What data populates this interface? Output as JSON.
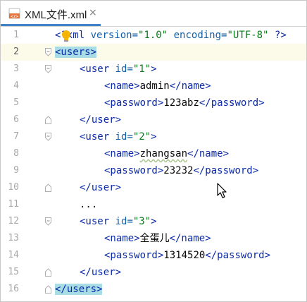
{
  "tab": {
    "title": "XML文件.xml",
    "close_glyph": "×",
    "file_icon": "xml-file-icon"
  },
  "line_numbers": [
    "1",
    "2",
    "3",
    "4",
    "5",
    "6",
    "7",
    "8",
    "9",
    "10",
    "11",
    "12",
    "13",
    "14",
    "15",
    "16"
  ],
  "lines": {
    "l1": {
      "lt": "<",
      "rest_tag": "?xml",
      "attr1": " version=",
      "val1": "\"1.0\"",
      "attr2": " encoding=",
      "val2": "\"UTF-8\"",
      "end": " ?>"
    },
    "l2": {
      "open": "<users>"
    },
    "l3": {
      "tag": "<user",
      "attr": " id=",
      "val": "\"1\"",
      "close": ">"
    },
    "l4": {
      "open": "<name>",
      "text": "admin",
      "close": "</name>"
    },
    "l5": {
      "open": "<password>",
      "text": "123abz",
      "close": "</password>"
    },
    "l6": {
      "close": "</user>"
    },
    "l7": {
      "tag": "<user",
      "attr": " id=",
      "val": "\"2\"",
      "close": ">"
    },
    "l8": {
      "open": "<name>",
      "text": "zhangsan",
      "close": "</name>"
    },
    "l9": {
      "open": "<password>",
      "text": "23232",
      "close": "</password>"
    },
    "l10": {
      "close": "</user>"
    },
    "l11": {
      "text": "..."
    },
    "l12": {
      "tag": "<user",
      "attr": " id=",
      "val": "\"3\"",
      "close": ">"
    },
    "l13": {
      "open": "<name>",
      "text": "全蛋儿",
      "close": "</name>"
    },
    "l14": {
      "open": "<password>",
      "text": "1314520",
      "close": "</password>"
    },
    "l15": {
      "close": "</user>"
    },
    "l16": {
      "close": "</users>"
    }
  },
  "colors": {
    "tag": "#0b2aa8",
    "attribute": "#125ea8",
    "attribute_value": "#067d17",
    "tag_highlight": "#a8dde6",
    "current_line": "#fcfae9",
    "tab_underline": "#4083c9"
  },
  "icons": {
    "intention": "lightbulb-icon",
    "pointer": "mouse-cursor-icon"
  }
}
